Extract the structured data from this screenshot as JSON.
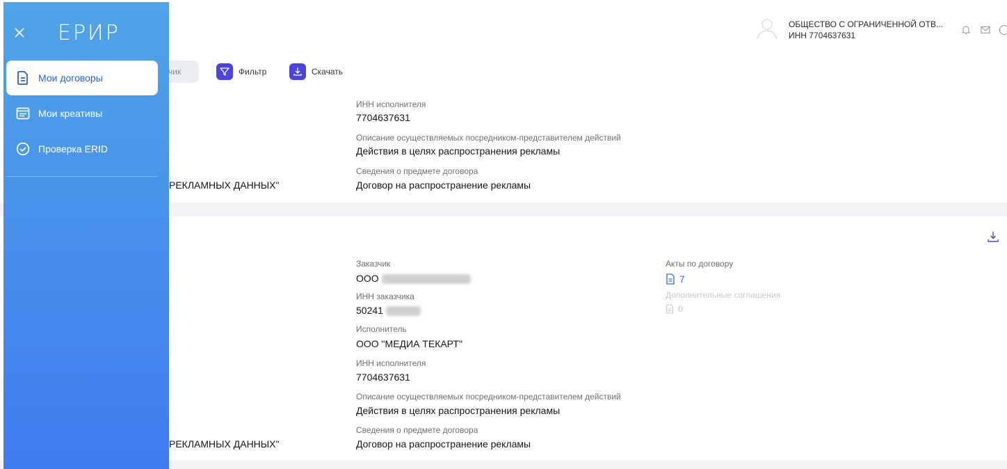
{
  "sidebar": {
    "logo": "ЕРИР",
    "items": [
      {
        "label": "Мои договоры",
        "icon": "document-icon",
        "active": true
      },
      {
        "label": "Мои креативы",
        "icon": "browser-window-icon",
        "active": false
      },
      {
        "label": "Проверка ERID",
        "icon": "shield-check-icon",
        "active": false
      }
    ]
  },
  "header": {
    "org_name": "ОБЩЕСТВО С ОГРАНИЧЕННОЙ ОТВ...",
    "org_inn": "ИНН 7704637631"
  },
  "toolbar": {
    "search_placeholder_fragment": "чик",
    "filter_label": "Фильтр",
    "download_label": "Скачать"
  },
  "card1": {
    "executor_inn_label": "ИНН исполнителя",
    "executor_inn": "7704637631",
    "actions_label": "Описание осуществляемых посредником-представителем действий",
    "actions_value": "Действия в целях распространения рекламы",
    "subject_label": "Сведения о предмете договора",
    "subject_value": "Договор на распространение рекламы",
    "left_fragment": "РЕКЛАМНЫХ ДАННЫХ\""
  },
  "card2": {
    "customer_label": "Заказчик",
    "customer_value": "ООО",
    "customer_inn_label": "ИНН заказчика",
    "customer_inn": "50241",
    "executor_label": "Исполнитель",
    "executor_value": "ООО \"МЕДИА ТЕКАРТ\"",
    "executor_inn_label": "ИНН исполнителя",
    "executor_inn": "7704637631",
    "actions_label": "Описание осуществляемых посредником-представителем действий",
    "actions_value": "Действия в целях распространения рекламы",
    "subject_label": "Сведения о предмете договора",
    "subject_value": "Договор на распространение рекламы",
    "left_fragment": "РЕКЛАМНЫХ ДАННЫХ\"",
    "acts_label": "Акты по договору",
    "acts_count": "7",
    "agreements_label": "Дополнительные соглашения",
    "agreements_count": "0"
  },
  "colors": {
    "accent": "#4b44e0",
    "link": "#2a6fdb",
    "sidebar_top": "#4fa4e8",
    "sidebar_bottom": "#3f7bf0"
  }
}
